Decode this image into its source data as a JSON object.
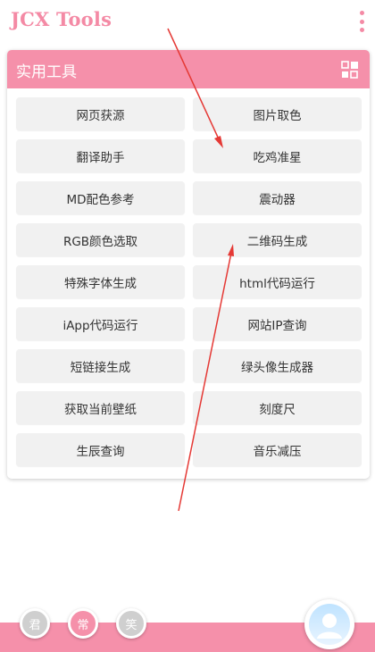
{
  "app": {
    "title": "JCX Tools",
    "accent_color": "#f590aa",
    "title_color": "#f48aa5"
  },
  "header": {
    "menu_icon": "more-vertical-icon"
  },
  "card": {
    "title": "实用工具",
    "layout_icon": "grid-view-icon"
  },
  "tools": [
    "网页获源",
    "图片取色",
    "翻译助手",
    "吃鸡准星",
    "MD配色参考",
    "震动器",
    "RGB颜色选取",
    "二维码生成",
    "特殊字体生成",
    "html代码运行",
    "iApp代码运行",
    "网站IP查询",
    "短链接生成",
    "绿头像生成器",
    "获取当前壁纸",
    "刻度尺",
    "生辰查询",
    "音乐减压"
  ],
  "bottom_nav": {
    "chips": [
      "君",
      "常",
      "笑"
    ],
    "active_index": 1,
    "avatar_icon": "user-avatar-icon"
  },
  "annotation_color": "#e53935"
}
